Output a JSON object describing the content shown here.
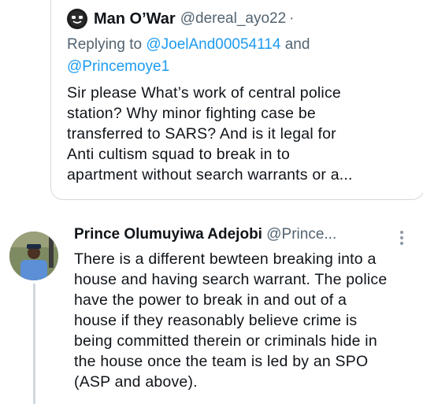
{
  "quoted_tweet": {
    "author_name": "Man O’War",
    "author_handle": "@dereal_ayo22",
    "separator": "·",
    "replying_to_prefix": "Replying to ",
    "mention_1": "@JoelAnd00054114",
    "and_word": " and",
    "mention_2": "@Princemoye1",
    "text": "Sir please What’s work of central police\nstation? Why minor fighting case be\ntransferred to SARS? And is it legal for\nAnti cultism squad to break in to\napartment without search warrants or a..."
  },
  "reply_tweet": {
    "author_name": "Prince Olumuyiwa Adejobi",
    "author_handle": "@Prince...",
    "text": "There is a different bewteen breaking into a\nhouse and having search warrant. The police\nhave the power to break in and out of a\nhouse if they reasonably believe crime is\nbeing committed therein or criminals hide in\nthe house once the team is led by an SPO\n(ASP and above)."
  },
  "icons": {
    "quote_avatar": "emoji-face-icon",
    "reply_avatar": "profile-photo-avatar",
    "more": "more-vertical-icon"
  },
  "colors": {
    "text": "#0f1419",
    "secondary": "#536471",
    "mention": "#1d9bf0",
    "border": "#d4d9de"
  }
}
